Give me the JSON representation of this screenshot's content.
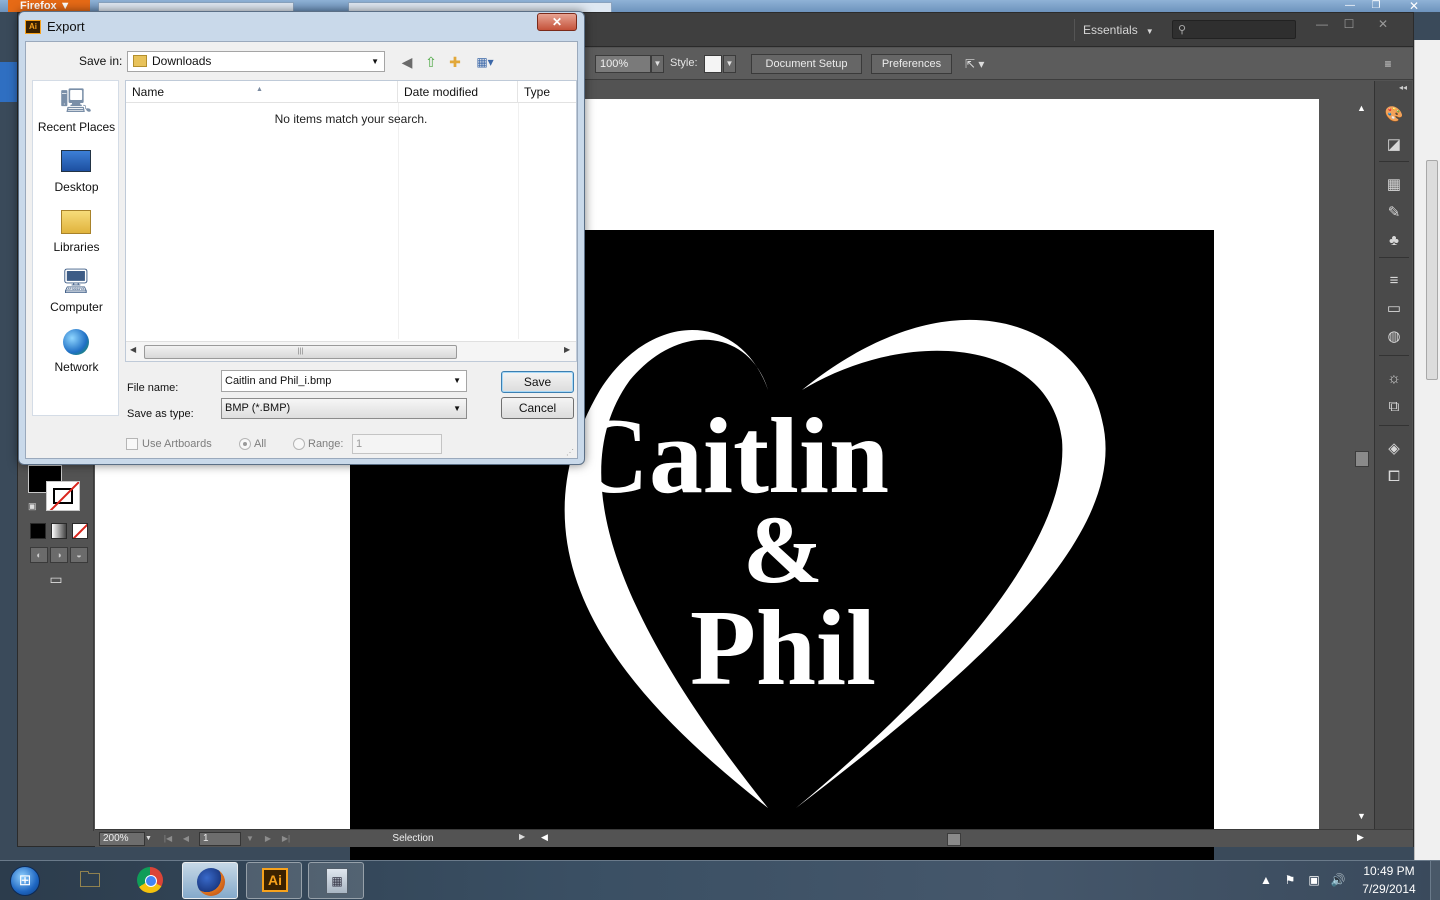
{
  "browser": {
    "menu_label": "Firefox ▼",
    "window_controls": {
      "minimize": "—",
      "maximize": "❐",
      "close": "✕"
    }
  },
  "illustrator": {
    "workspace": "Essentials",
    "window_controls": {
      "minimize": "—",
      "maximize": "☐",
      "close": "✕"
    },
    "control_bar": {
      "opacity_value": "100%",
      "style_label": "Style:",
      "document_setup_label": "Document Setup",
      "preferences_label": "Preferences"
    },
    "status_bar": {
      "zoom": "200%",
      "artboard_number": "1",
      "status_text": "Selection"
    },
    "artwork": {
      "line1": "Caitlin",
      "line2": "&",
      "line3": "Phil"
    }
  },
  "export_dialog": {
    "title": "Export",
    "close_label": "✕",
    "save_in_label": "Save in:",
    "save_in_value": "Downloads",
    "places": [
      {
        "label": "Recent Places",
        "icon": "recent-places-icon"
      },
      {
        "label": "Desktop",
        "icon": "desktop-icon"
      },
      {
        "label": "Libraries",
        "icon": "libraries-icon"
      },
      {
        "label": "Computer",
        "icon": "computer-icon"
      },
      {
        "label": "Network",
        "icon": "network-icon"
      }
    ],
    "columns": [
      "Name",
      "Date modified",
      "Type"
    ],
    "empty_message": "No items match your search.",
    "file_name_label": "File name:",
    "file_name_value": "Caitlin and Phil_i.bmp",
    "save_as_type_label": "Save as type:",
    "save_as_type_value": "BMP (*.BMP)",
    "save_label": "Save",
    "cancel_label": "Cancel",
    "use_artboards_label": "Use Artboards",
    "all_label": "All",
    "range_label": "Range:",
    "range_value": "1"
  },
  "taskbar": {
    "apps": [
      {
        "name": "Windows Explorer",
        "icon": "folder-icon"
      },
      {
        "name": "Google Chrome",
        "icon": "chrome-icon"
      },
      {
        "name": "Firefox",
        "icon": "firefox-icon"
      },
      {
        "name": "Adobe Illustrator",
        "icon": "illustrator-icon",
        "glyph": "Ai"
      },
      {
        "name": "Calculator",
        "icon": "calculator-icon"
      }
    ],
    "clock_time": "10:49 PM",
    "clock_date": "7/29/2014"
  },
  "colors": {
    "artboard_bg": "#000000",
    "art_fg": "#ffffff",
    "ui_dark": "#535353",
    "dialog_frame": "#c9d9ea",
    "firefox_orange": "#e66a16"
  }
}
